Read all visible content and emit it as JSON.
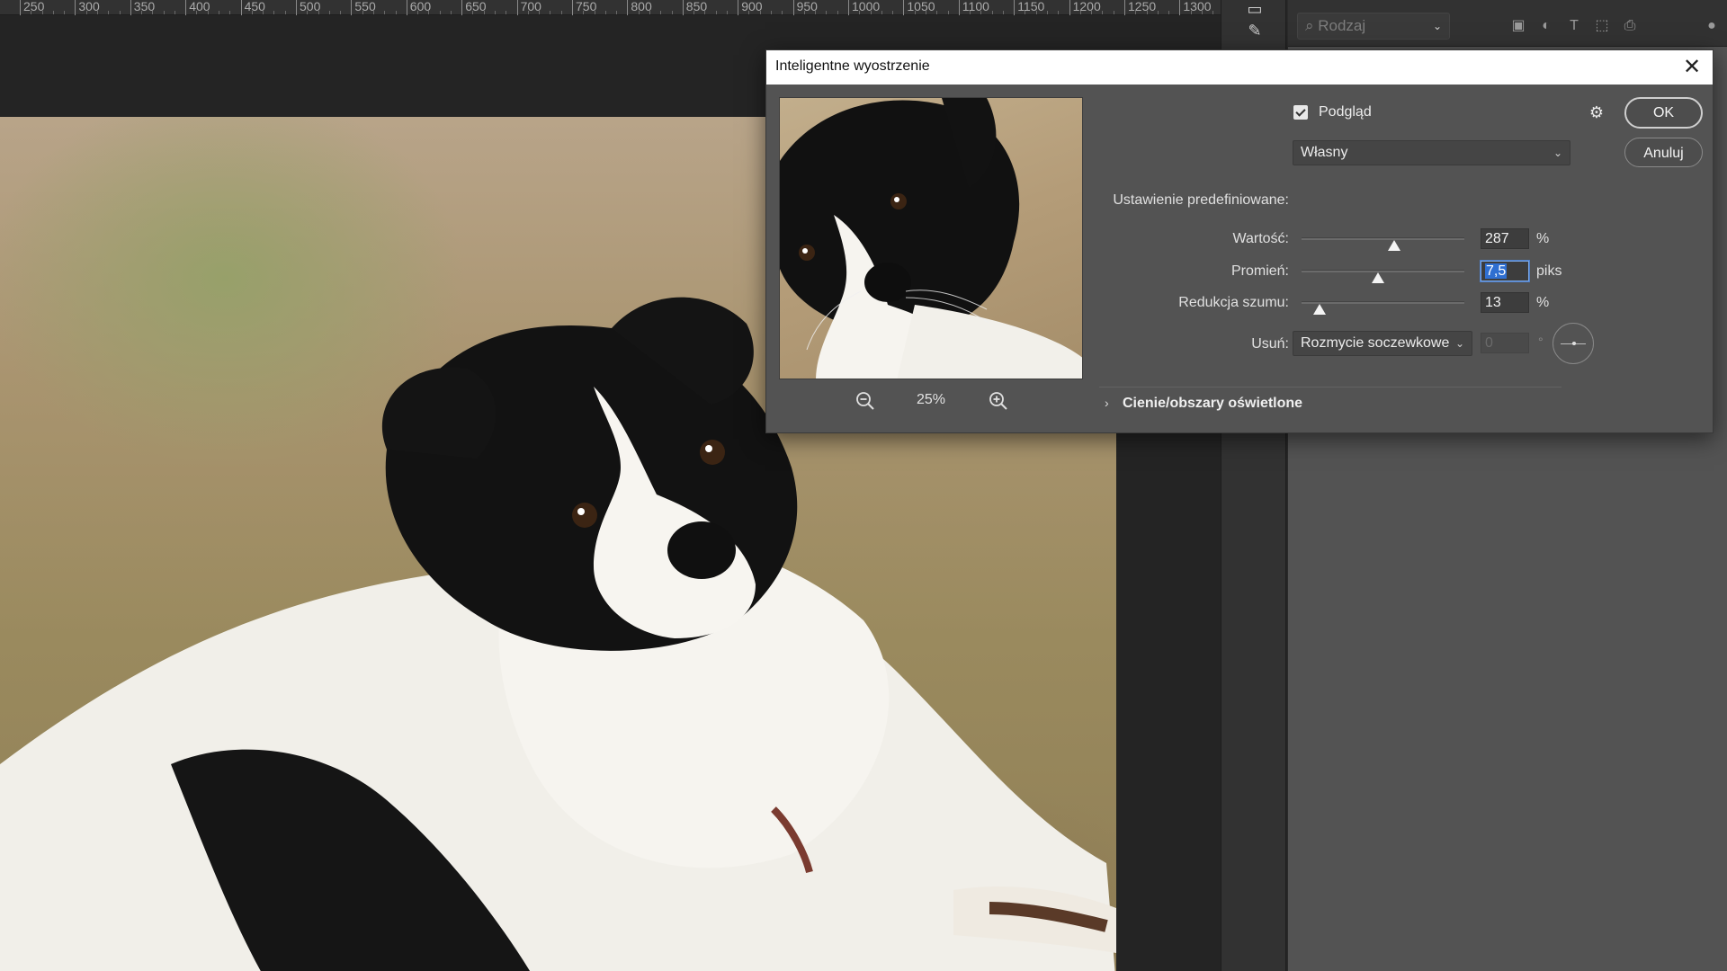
{
  "ruler": {
    "ticks": [
      "250",
      "300",
      "350",
      "400",
      "450",
      "500",
      "550",
      "600",
      "650",
      "700",
      "750",
      "800",
      "850",
      "900",
      "950",
      "1000",
      "1050",
      "1100",
      "1150",
      "1200",
      "1250",
      "1300"
    ]
  },
  "layers_panel": {
    "kind_filter_placeholder": "Rodzaj"
  },
  "dialog": {
    "title": "Inteligentne wyostrzenie",
    "close_glyph": "✕",
    "ok_label": "OK",
    "cancel_label": "Anuluj",
    "preview": {
      "label": "Podgląd",
      "checked": true,
      "zoom_level": "25%"
    },
    "preset": {
      "label": "Ustawienie predefiniowane:",
      "value": "Własny"
    },
    "amount": {
      "label": "Wartość:",
      "value": "287",
      "unit": "%",
      "slider_fraction": 0.57
    },
    "radius": {
      "label": "Promień:",
      "value": "7,5",
      "unit": "piks",
      "slider_fraction": 0.47
    },
    "noise_reduction": {
      "label": "Redukcja szumu:",
      "value": "13",
      "unit": "%",
      "slider_fraction": 0.11
    },
    "remove": {
      "label": "Usuń:",
      "value": "Rozmycie soczewkowe",
      "angle_value": "0",
      "angle_unit": "°"
    },
    "section": {
      "label": "Cienie/obszary oświetlone"
    }
  }
}
